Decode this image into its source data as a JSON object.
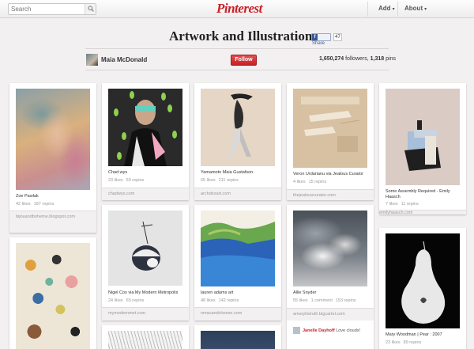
{
  "topbar": {
    "search_placeholder": "Search",
    "logo": "Pinterest",
    "nav": [
      {
        "label": "Add",
        "caret": "▾"
      },
      {
        "label": "About",
        "caret": "▾"
      }
    ]
  },
  "board": {
    "title": "Artwork and Illustrations",
    "fb_share": "Share",
    "fb_count": "47",
    "user": "Maia McDonald",
    "follow_label": "Follow",
    "followers": "1,650,274",
    "followers_label": "followers,",
    "pins": "1,318",
    "pins_label": "pins"
  },
  "pins": [
    {
      "caption": "Zoe Pawlak",
      "likes": "42 likes",
      "repins": "187 repins",
      "source": "bijouandboheme.blogspot.com"
    },
    {
      "caption": "",
      "likes": "",
      "repins": "",
      "source": ""
    },
    {
      "caption": "Chad wys",
      "likes": "23 likes",
      "repins": "50 repins",
      "source": "chadwys.com"
    },
    {
      "caption": "Nigel Cox via My Modern Metropolis",
      "likes": "24 likes",
      "repins": "65 repins",
      "source": "mymodernmet.com"
    },
    {
      "caption": "",
      "likes": "",
      "repins": "",
      "source": ""
    },
    {
      "caption": "Yamamoto Maia Gustafson",
      "likes": "65 likes",
      "repins": "211 repins",
      "source": "archdezart.com"
    },
    {
      "caption": "lauren adams art",
      "likes": "48 likes",
      "repins": "142 repins",
      "source": "nmacandcheese.com"
    },
    {
      "caption": "",
      "likes": "",
      "repins": "",
      "source": ""
    },
    {
      "caption": "Veron Urdarianu via Jealous Curator",
      "likes": "4 likes",
      "repins": "15 repins",
      "source": "thejealouscurator.com"
    },
    {
      "caption": "Allie Snyder",
      "likes": "55 likes",
      "comments": "1 comment",
      "repins": "153 repins",
      "source": "amarylistruth.bigcartel.com",
      "comment_user": "Janelle Dayhoff",
      "comment_text": "Love clouds!"
    },
    {
      "caption": "Some Assembly Required - Emily Haasch",
      "likes": "7 likes",
      "repins": "11 repins",
      "source": "emilyhaasch.com"
    },
    {
      "caption": "Mary Woodman | Pear : 2007",
      "likes": "23 likes",
      "repins": "89 repins",
      "source": ""
    }
  ]
}
